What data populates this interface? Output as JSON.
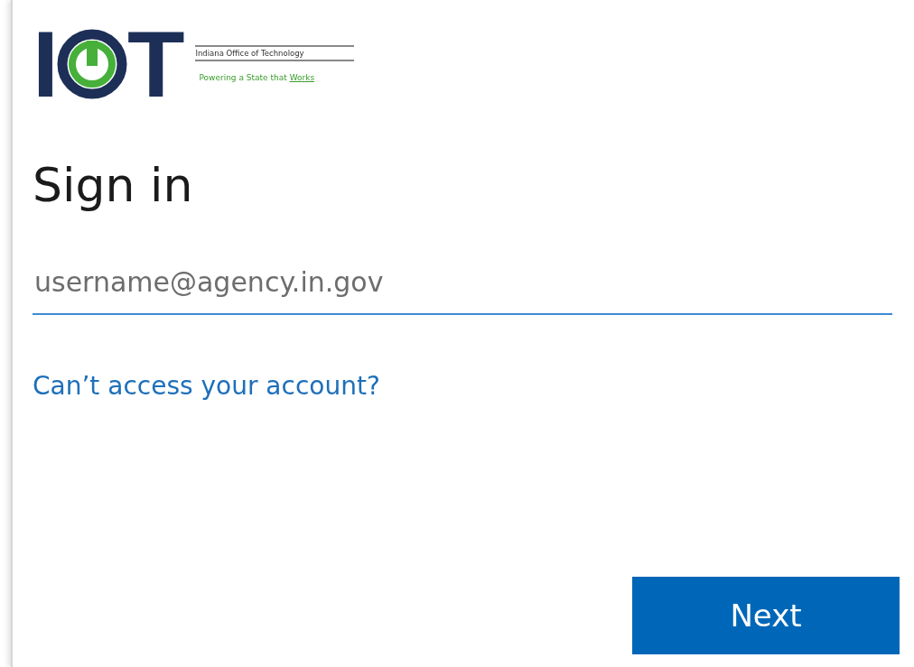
{
  "logo": {
    "letter_left": "I",
    "letter_right": "T",
    "org_name": "Indiana Office of Technology",
    "tagline": "Powering a State that **Works**"
  },
  "heading": "Sign in",
  "username": {
    "placeholder": "username@agency.in.gov"
  },
  "help_link": "Can’t access your account?",
  "buttons": [
    {
      "label": "Next",
      "kind": "primary"
    }
  ]
}
